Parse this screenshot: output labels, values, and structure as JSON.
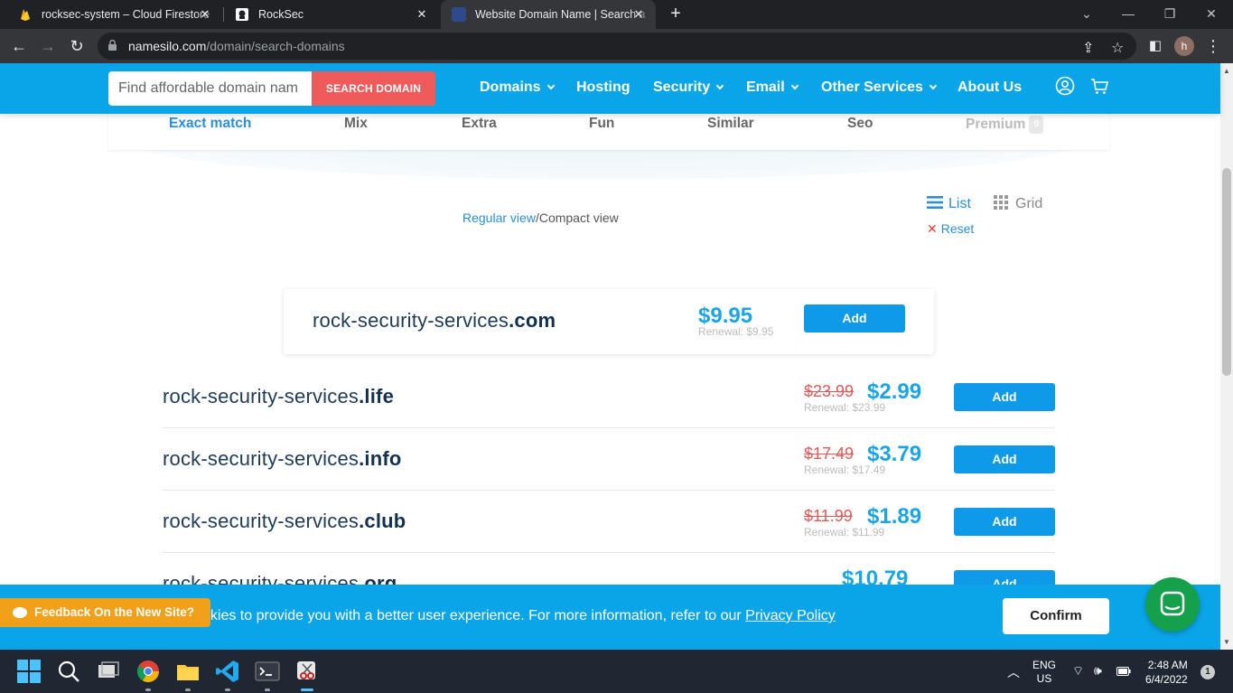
{
  "browser": {
    "tabs": [
      {
        "title": "rocksec-system – Cloud Firestore",
        "icon": "firebase-icon",
        "color": "#f6a31b"
      },
      {
        "title": "RockSec",
        "icon": "rocksec-icon",
        "color": "#ffffff"
      },
      {
        "title": "Website Domain Name | Search a",
        "icon": "namesilo-icon",
        "color": "#2f4a8a"
      }
    ],
    "url_domain": "namesilo.com",
    "url_path": "/domain/search-domains",
    "profile_initial": "h"
  },
  "site_nav": {
    "search_placeholder": "Find affordable domain nam",
    "search_button": "SEARCH DOMAIN",
    "menu": [
      "Domains",
      "Hosting",
      "Security",
      "Email",
      "Other Services",
      "About Us"
    ]
  },
  "filters": {
    "tabs": [
      "Exact match",
      "Mix",
      "Extra",
      "Fun",
      "Similar",
      "Seo",
      "Premium"
    ],
    "premium_count": "0"
  },
  "view": {
    "regular": "Regular view",
    "separator": "/",
    "compact": "Compact view",
    "list": "List",
    "grid": "Grid",
    "reset": "Reset"
  },
  "top_result": {
    "name": "rock-security-services",
    "tld": ".com",
    "price": "$9.95",
    "renewal": "Renewal: $9.95",
    "button": "Add"
  },
  "results": [
    {
      "name": "rock-security-services",
      "tld": ".life",
      "old_price": "$23.99",
      "price": "$2.99",
      "renewal": "Renewal: $23.99",
      "button": "Add"
    },
    {
      "name": "rock-security-services",
      "tld": ".info",
      "old_price": "$17.49",
      "price": "$3.79",
      "renewal": "Renewal: $17.49",
      "button": "Add"
    },
    {
      "name": "rock-security-services",
      "tld": ".club",
      "old_price": "$11.99",
      "price": "$1.89",
      "renewal": "Renewal: $11.99",
      "button": "Add"
    },
    {
      "name": "rock-security-services",
      "tld": ".org",
      "old_price": "",
      "price": "$10.79",
      "renewal": "",
      "button": "Add"
    }
  ],
  "cookie": {
    "text": "okies to provide you with a better user experience. For more information, refer to our ",
    "link": "Privacy Policy",
    "confirm": "Confirm"
  },
  "feedback": "Feedback On the New Site?",
  "taskbar": {
    "lang": "ENG",
    "region": "US",
    "time": "2:48 AM",
    "date": "6/4/2022",
    "notifications": "1"
  }
}
